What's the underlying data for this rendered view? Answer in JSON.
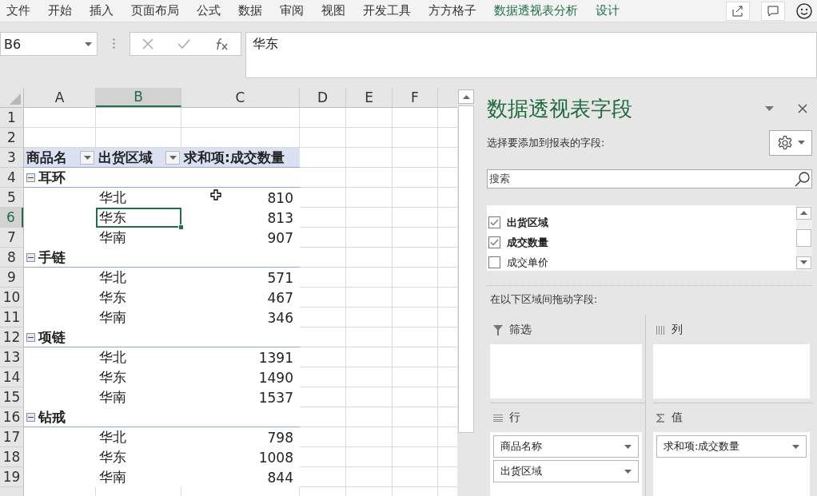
{
  "ribbon_tabs": [
    {
      "label": "文件",
      "kind": "normal"
    },
    {
      "label": "开始",
      "kind": "normal"
    },
    {
      "label": "插入",
      "kind": "normal"
    },
    {
      "label": "页面布局",
      "kind": "normal"
    },
    {
      "label": "公式",
      "kind": "normal"
    },
    {
      "label": "数据",
      "kind": "normal"
    },
    {
      "label": "审阅",
      "kind": "normal"
    },
    {
      "label": "视图",
      "kind": "normal"
    },
    {
      "label": "开发工具",
      "kind": "normal"
    },
    {
      "label": "方方格子",
      "kind": "normal"
    },
    {
      "label": "数据透视表分析",
      "kind": "context"
    },
    {
      "label": "设计",
      "kind": "context"
    }
  ],
  "name_box": "B6",
  "formula": "华东",
  "columns": [
    {
      "label": "A",
      "selected": false
    },
    {
      "label": "B",
      "selected": true
    },
    {
      "label": "C",
      "selected": false
    },
    {
      "label": "D",
      "selected": false
    },
    {
      "label": "E",
      "selected": false
    },
    {
      "label": "F",
      "selected": false
    }
  ],
  "sheet_rows": [
    {
      "number": "1",
      "kind": "blank"
    },
    {
      "number": "2",
      "kind": "blank"
    },
    {
      "number": "3",
      "kind": "header",
      "cells": [
        "商品名",
        "出货区域",
        "求和项:成交数量"
      ]
    },
    {
      "number": "4",
      "kind": "group",
      "label": "耳环",
      "expanded": true
    },
    {
      "number": "5",
      "kind": "item",
      "region": "华北",
      "value": "810",
      "selected": false
    },
    {
      "number": "6",
      "kind": "item",
      "region": "华东",
      "value": "813",
      "selected": true
    },
    {
      "number": "7",
      "kind": "item",
      "region": "华南",
      "value": "907",
      "selected": false
    },
    {
      "number": "8",
      "kind": "group",
      "label": "手链",
      "expanded": true
    },
    {
      "number": "9",
      "kind": "item",
      "region": "华北",
      "value": "571",
      "selected": false
    },
    {
      "number": "10",
      "kind": "item",
      "region": "华东",
      "value": "467",
      "selected": false
    },
    {
      "number": "11",
      "kind": "item",
      "region": "华南",
      "value": "346",
      "selected": false
    },
    {
      "number": "12",
      "kind": "group",
      "label": "项链",
      "expanded": true
    },
    {
      "number": "13",
      "kind": "item",
      "region": "华北",
      "value": "1391",
      "selected": false
    },
    {
      "number": "14",
      "kind": "item",
      "region": "华东",
      "value": "1490",
      "selected": false
    },
    {
      "number": "15",
      "kind": "item",
      "region": "华南",
      "value": "1537",
      "selected": false
    },
    {
      "number": "16",
      "kind": "group",
      "label": "钻戒",
      "expanded": true
    },
    {
      "number": "17",
      "kind": "item",
      "region": "华北",
      "value": "798",
      "selected": false
    },
    {
      "number": "18",
      "kind": "item",
      "region": "华东",
      "value": "1008",
      "selected": false
    },
    {
      "number": "19",
      "kind": "item",
      "region": "华南",
      "value": "844",
      "selected": false
    }
  ],
  "pane": {
    "title": "数据透视表字段",
    "subtitle": "选择要添加到报表的字段:",
    "search": {
      "placeholder": "搜索"
    },
    "fields": [
      {
        "label": "出货区域",
        "checked": true
      },
      {
        "label": "成交数量",
        "checked": true
      },
      {
        "label": "成交单价",
        "checked": false
      }
    ],
    "drag_hint": "在以下区域间拖动字段:",
    "areas": [
      {
        "kind": "filter",
        "label": "筛选"
      },
      {
        "kind": "column",
        "label": "列"
      },
      {
        "kind": "row",
        "label": "行",
        "items": [
          "商品名称",
          "出货区域"
        ]
      },
      {
        "kind": "value",
        "label": "值",
        "items": [
          "求和项:成交数量"
        ]
      }
    ]
  }
}
